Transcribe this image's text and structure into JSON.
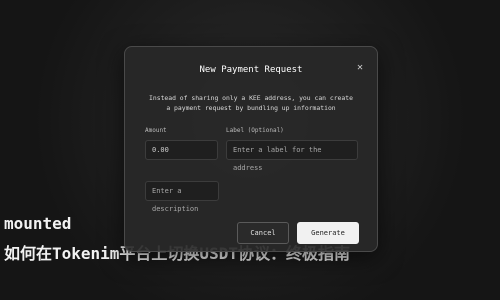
{
  "background": {
    "line1": "mounted",
    "line2": "如何在Tokenim平台上切换USDT协议：终极指南"
  },
  "dialog": {
    "title": "New Payment Request",
    "close_glyph": "✕",
    "description_line1": "Instead of sharing only a KEE address, you can create",
    "description_line2": "a payment request by bundling up information",
    "amount_label": "Amount",
    "amount_value": "0.00",
    "label_label": "Label (Optional)",
    "label_placeholder": "Enter a label for the address",
    "description_placeholder": "Enter a description",
    "cancel_label": "Cancel",
    "generate_label": "Generate"
  }
}
